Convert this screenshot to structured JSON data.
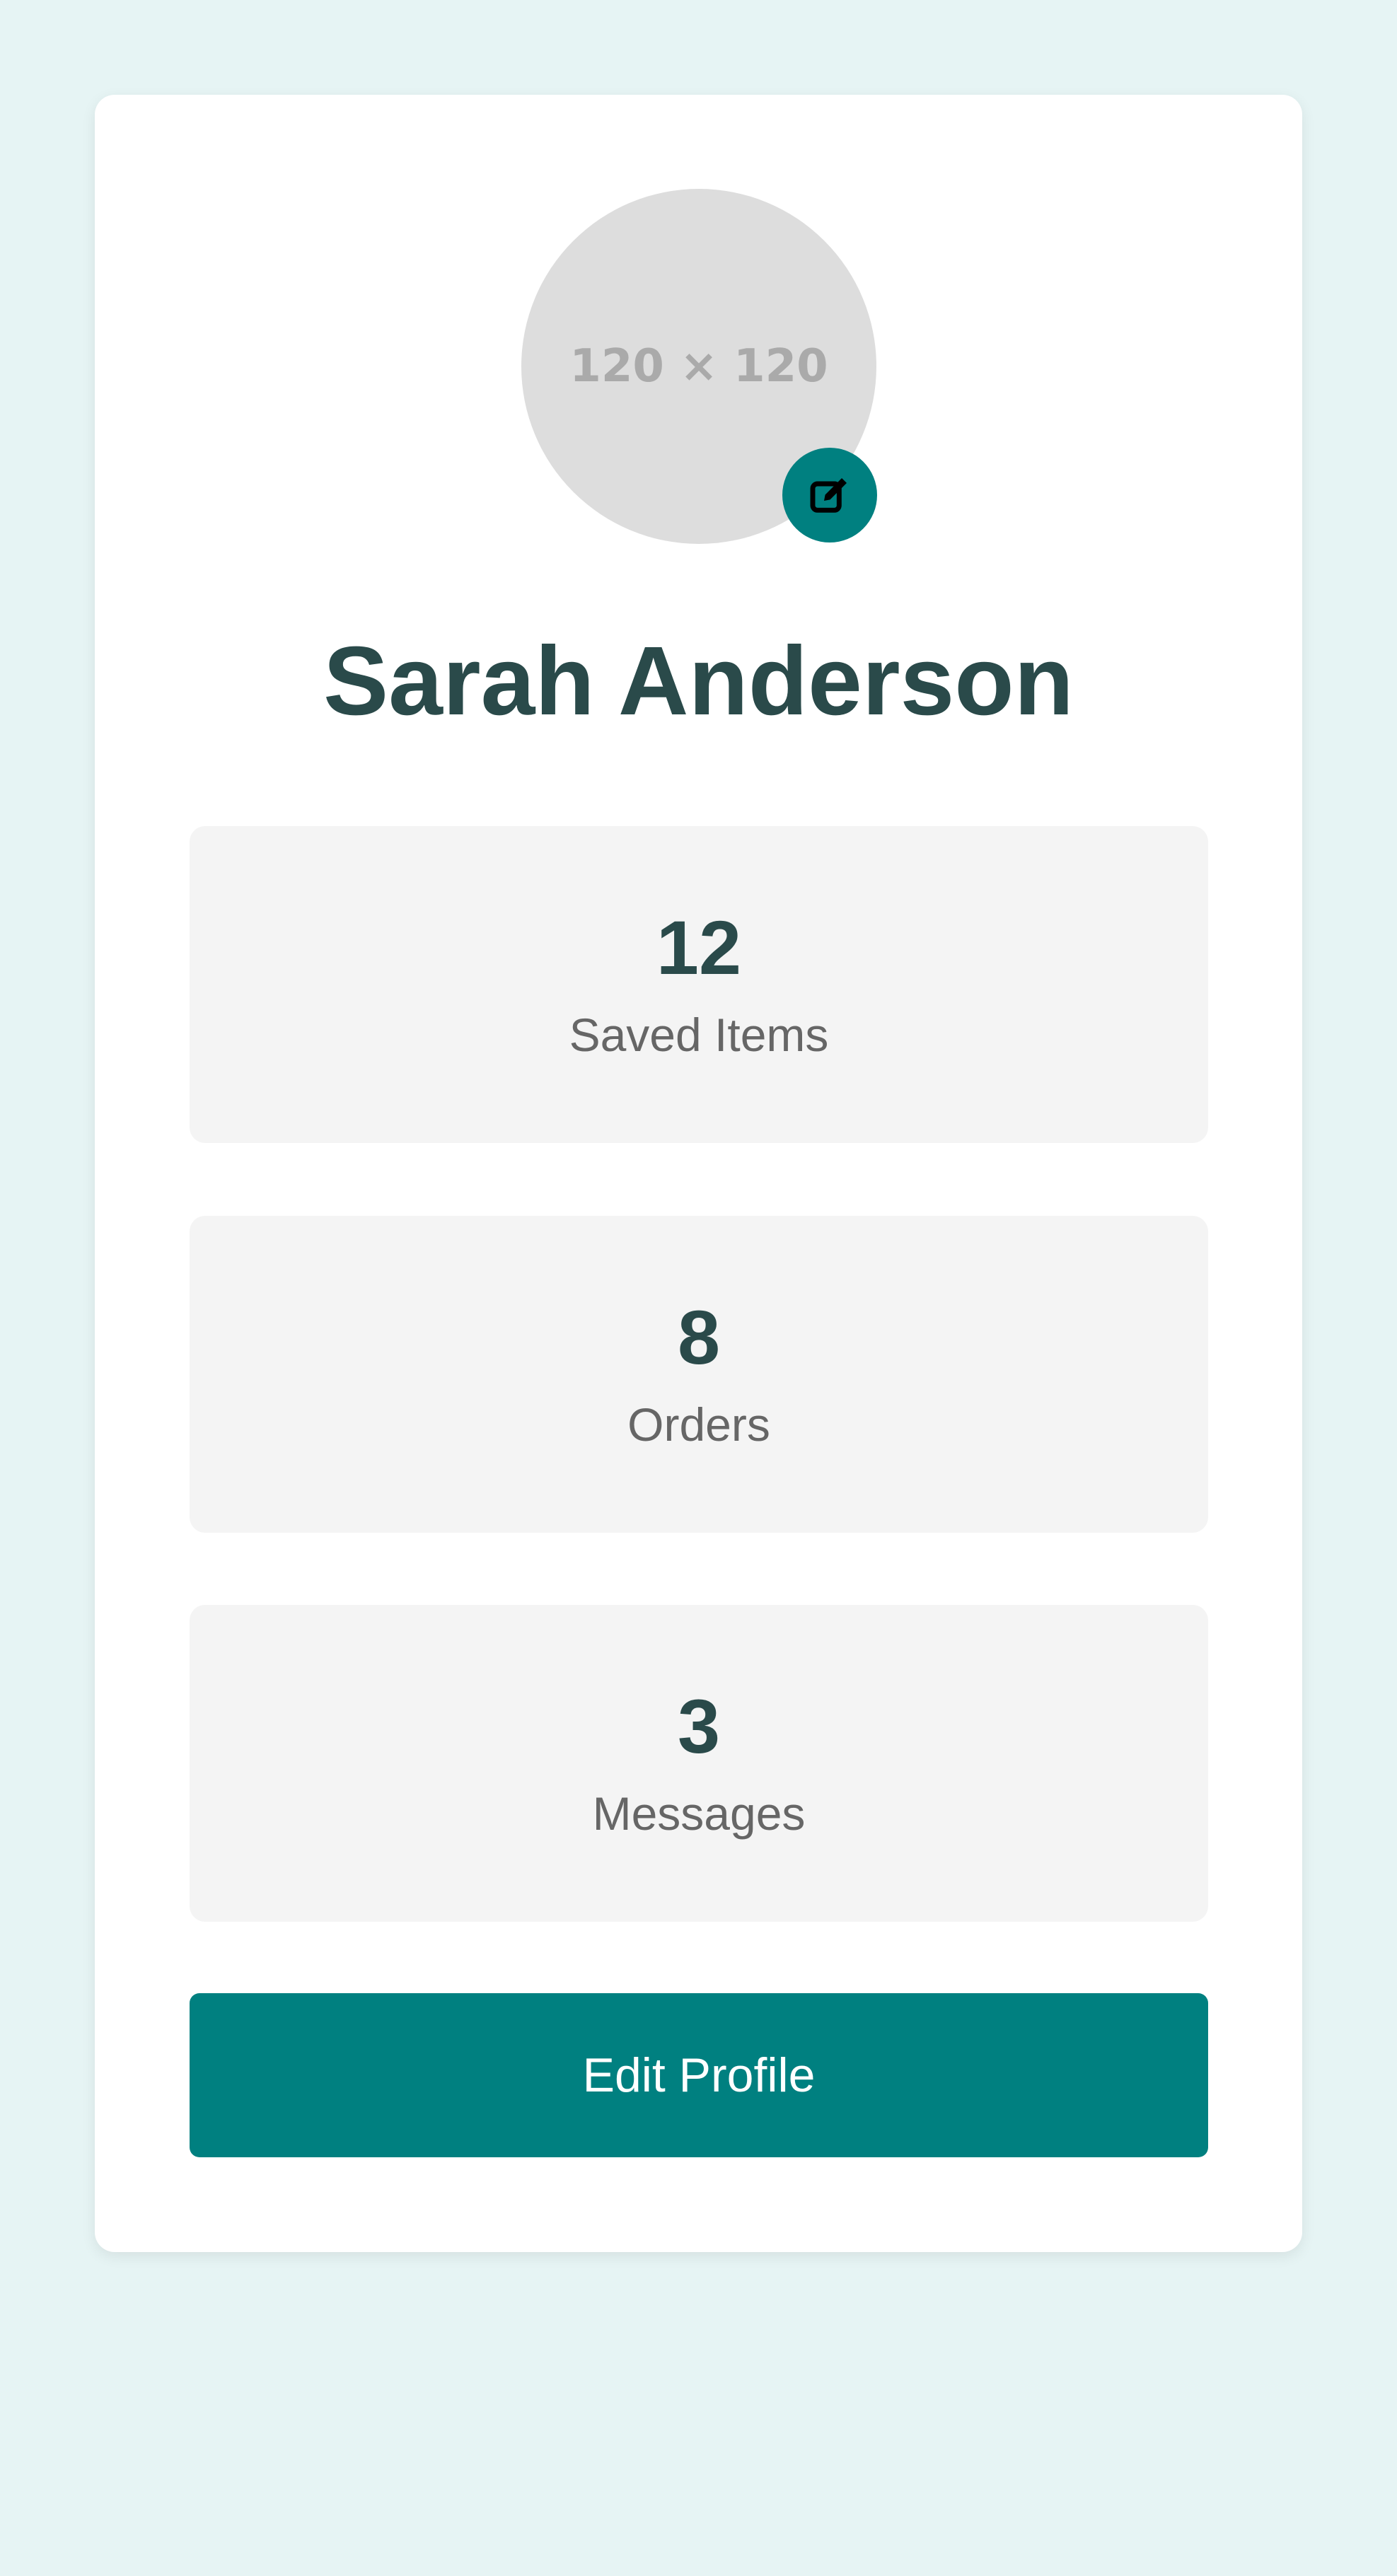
{
  "profile": {
    "avatar_placeholder": "120 × 120",
    "name": "Sarah Anderson"
  },
  "stats": [
    {
      "value": "12",
      "label": "Saved Items"
    },
    {
      "value": "8",
      "label": "Orders"
    },
    {
      "value": "3",
      "label": "Messages"
    }
  ],
  "actions": {
    "edit_profile_label": "Edit Profile"
  },
  "colors": {
    "accent": "#008080",
    "page_background": "#e6f4f4",
    "heading": "#2a4a4a",
    "stat_background": "#f4f4f4"
  },
  "icons": {
    "avatar_edit": "pencil-square-icon"
  }
}
